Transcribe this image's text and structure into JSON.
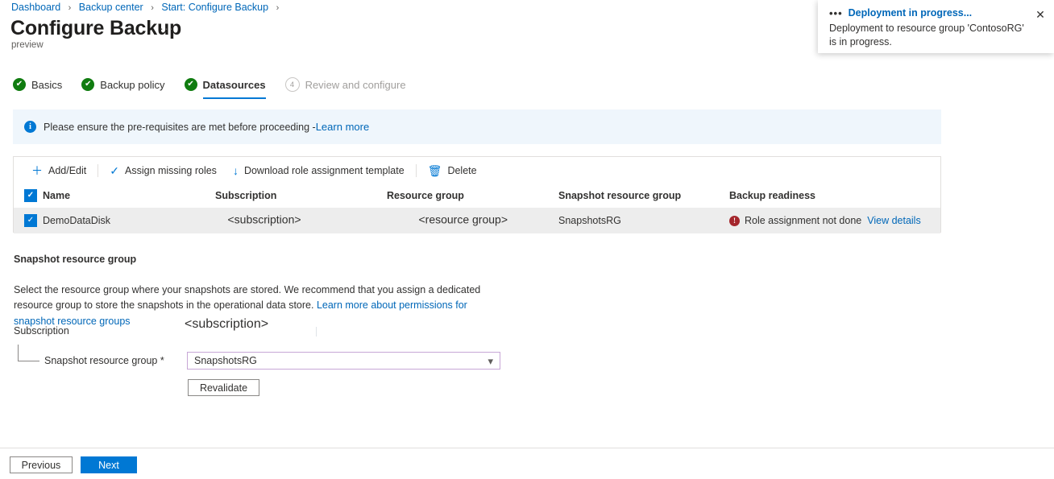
{
  "breadcrumb": {
    "items": [
      "Dashboard",
      "Backup center",
      "Start: Configure Backup"
    ],
    "separator": "›"
  },
  "header": {
    "title": "Configure Backup",
    "ellipsis": "···",
    "subtitle": "preview"
  },
  "steps": [
    {
      "label": "Basics",
      "state": "done",
      "glyph": "✔"
    },
    {
      "label": "Backup policy",
      "state": "done",
      "glyph": "✔"
    },
    {
      "label": "Datasources",
      "state": "current",
      "glyph": "✔"
    },
    {
      "label": "Review and configure",
      "state": "disabled",
      "glyph": "4"
    }
  ],
  "info_banner": {
    "icon": "info-icon",
    "text": "Please ensure the pre-requisites are met before proceeding - ",
    "link": "Learn more"
  },
  "toolbar": {
    "commands": [
      {
        "icon": "plus-icon",
        "glyph": "＋",
        "label": "Add/Edit"
      },
      {
        "icon": "check-icon",
        "glyph": "✓",
        "label": "Assign missing roles"
      },
      {
        "icon": "download-icon",
        "glyph": "↓",
        "label": "Download role assignment template"
      },
      {
        "icon": "trash-icon",
        "glyph": "🗑",
        "label": "Delete"
      }
    ]
  },
  "table": {
    "columns": [
      "Name",
      "Subscription",
      "Resource group",
      "Snapshot resource group",
      "Backup readiness"
    ],
    "header_checkbox_checked": true,
    "rows": [
      {
        "checked": true,
        "name": "DemoDataDisk",
        "subscription": "<subscription>",
        "resource_group": "<resource group>",
        "snapshot_resource_group": "SnapshotsRG",
        "readiness_status": "Role assignment not done",
        "readiness_link": "View details",
        "delete_icon": "trash-icon"
      }
    ]
  },
  "snapshot_section": {
    "title": "Snapshot resource group",
    "description": "Select the resource group where your snapshots are stored. We recommend that you assign a dedicated resource group to store the snapshots in the operational data store. ",
    "description_link": "Learn more about permissions for snapshot resource groups",
    "subscription_label": "Subscription",
    "subscription_value": "<subscription>",
    "srg_label": "Snapshot resource group *",
    "srg_value": "SnapshotsRG",
    "srg_caret": "⌄",
    "revalidate_label": "Revalidate"
  },
  "footer": {
    "previous_label": "Previous",
    "next_label": "Next"
  },
  "toast": {
    "dots": "•••",
    "title": "Deployment in progress...",
    "body": "Deployment to resource group 'ContosoRG' is in progress.",
    "close": "✕"
  },
  "colors": {
    "accent": "#0078d4",
    "link": "#0067b8",
    "success": "#107c10",
    "error": "#a4262c",
    "banner_bg": "#eff6fc",
    "row_bg": "#ededed",
    "field_border": "#c7a6d6"
  }
}
